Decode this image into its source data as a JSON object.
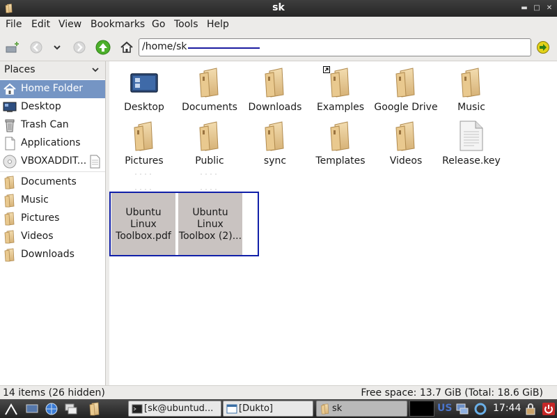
{
  "window": {
    "title": "sk"
  },
  "menu": [
    {
      "id": "file",
      "label": "File"
    },
    {
      "id": "edit",
      "label": "Edit"
    },
    {
      "id": "view",
      "label": "View"
    },
    {
      "id": "bookmarks",
      "label": "Bookmarks"
    },
    {
      "id": "go",
      "label": "Go"
    },
    {
      "id": "tools",
      "label": "Tools"
    },
    {
      "id": "help",
      "label": "Help"
    }
  ],
  "toolbar": {
    "path": "/home/sk"
  },
  "sidebar": {
    "header": "Places",
    "places": [
      {
        "label": "Home Folder",
        "icon": "home-icon"
      },
      {
        "label": "Desktop",
        "icon": "desktop-icon"
      },
      {
        "label": "Trash Can",
        "icon": "trash-icon"
      },
      {
        "label": "Applications",
        "icon": "applications-icon"
      },
      {
        "label": "VBOXADDIT...",
        "icon": "cdrom-icon"
      }
    ],
    "bookmarks": [
      {
        "label": "Documents",
        "icon": "folder-icon"
      },
      {
        "label": "Music",
        "icon": "folder-icon"
      },
      {
        "label": "Pictures",
        "icon": "folder-icon"
      },
      {
        "label": "Videos",
        "icon": "folder-icon"
      },
      {
        "label": "Downloads",
        "icon": "folder-icon"
      }
    ]
  },
  "files": [
    {
      "name": "Desktop",
      "icon": "desktop-icon"
    },
    {
      "name": "Documents",
      "icon": "folder-icon"
    },
    {
      "name": "Downloads",
      "icon": "folder-icon"
    },
    {
      "name": "Examples",
      "icon": "folder-link-icon"
    },
    {
      "name": "Google Drive",
      "icon": "folder-icon"
    },
    {
      "name": "Music",
      "icon": "folder-icon"
    },
    {
      "name": "Pictures",
      "icon": "folder-icon"
    },
    {
      "name": "Public",
      "icon": "folder-icon"
    },
    {
      "name": "sync",
      "icon": "folder-icon"
    },
    {
      "name": "Templates",
      "icon": "folder-icon"
    },
    {
      "name": "Videos",
      "icon": "folder-icon"
    },
    {
      "name": "Release.key",
      "icon": "text-file-icon"
    }
  ],
  "selected_files": [
    {
      "line1": "Ubuntu",
      "line2": "Linux",
      "line3": "Toolbox.pdf"
    },
    {
      "line1": "Ubuntu",
      "line2": "Linux",
      "line3": "Toolbox (2)..."
    }
  ],
  "status": {
    "items": "14 items (26 hidden)",
    "space": "Free space: 13.7 GiB (Total: 18.6 GiB)"
  },
  "taskbar": {
    "tasks": [
      {
        "label": "[sk@ubuntud...",
        "icon": "terminal-icon"
      },
      {
        "label": "[Dukto]",
        "icon": "window-icon"
      },
      {
        "label": "sk",
        "icon": "folder-icon"
      }
    ],
    "keyboard": "US",
    "clock": "17:44"
  },
  "colors": {
    "selection": "#7595c4",
    "highlight_border": "#0f1ea8",
    "folder": "#e8c98a"
  }
}
